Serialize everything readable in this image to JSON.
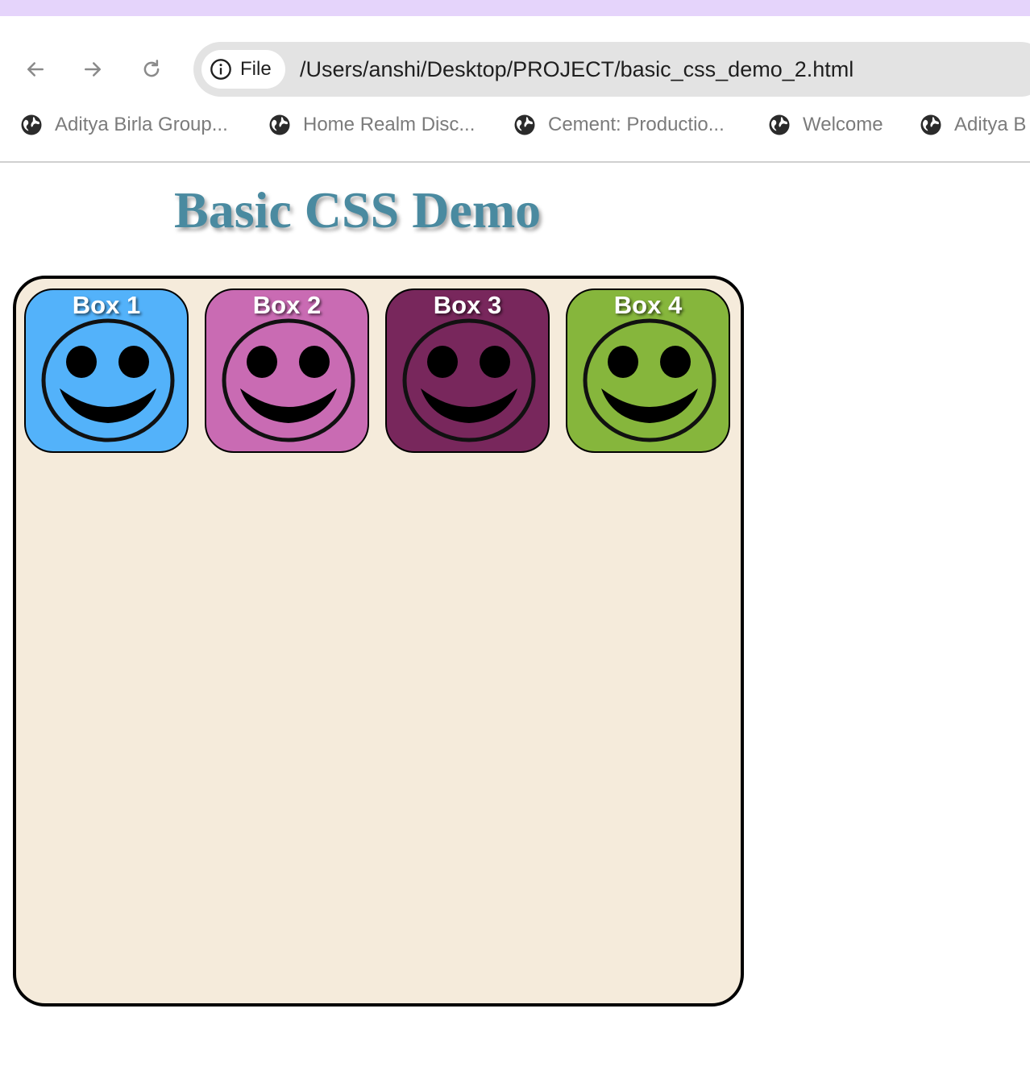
{
  "browser": {
    "url_scheme_label": "File",
    "url": "/Users/anshi/Desktop/PROJECT/basic_css_demo_2.html",
    "bookmarks": [
      {
        "label": "Aditya Birla Group..."
      },
      {
        "label": "Home Realm Disc..."
      },
      {
        "label": "Cement: Productio..."
      },
      {
        "label": "Welcome"
      },
      {
        "label": "Aditya B"
      }
    ]
  },
  "page": {
    "title": "Basic CSS Demo",
    "title_color": "#4a8aa0",
    "container_background": "#f5ebdb",
    "boxes": [
      {
        "label": "Box 1",
        "color": "#53b2fa",
        "icon": "smiley-icon"
      },
      {
        "label": "Box 2",
        "color": "#c96bb3",
        "icon": "smiley-icon"
      },
      {
        "label": "Box 3",
        "color": "#78275c",
        "icon": "smiley-icon"
      },
      {
        "label": "Box 4",
        "color": "#86b63c",
        "icon": "smiley-icon"
      }
    ]
  }
}
